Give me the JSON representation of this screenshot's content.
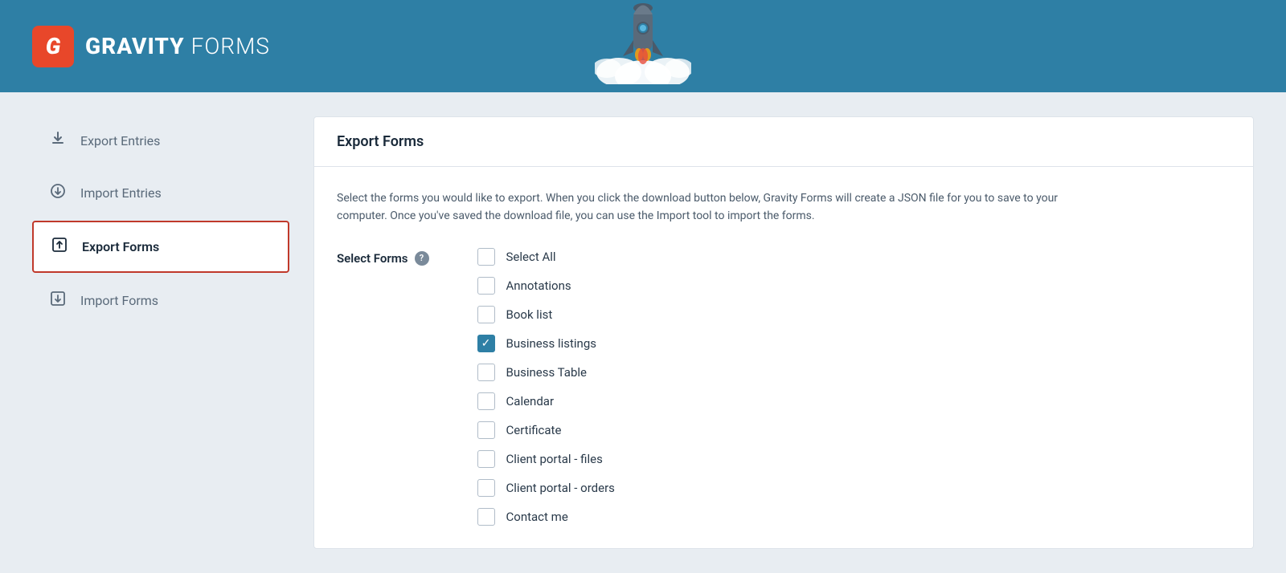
{
  "header": {
    "logo_letter": "G",
    "brand_gravity": "GRAVITY",
    "brand_forms": "FORMS"
  },
  "sidebar": {
    "items": [
      {
        "id": "export-entries",
        "label": "Export Entries",
        "icon": "⬆",
        "active": false
      },
      {
        "id": "import-entries",
        "label": "Import Entries",
        "icon": "↩",
        "active": false
      },
      {
        "id": "export-forms",
        "label": "Export Forms",
        "icon": "⬆",
        "active": true
      },
      {
        "id": "import-forms",
        "label": "Import Forms",
        "icon": "⬇",
        "active": false
      }
    ]
  },
  "content": {
    "panel_title": "Export Forms",
    "description": "Select the forms you would like to export. When you click the download button below, Gravity Forms will create a JSON file for you to save to your computer. Once you've saved the download file, you can use the Import tool to import the forms.",
    "select_forms_label": "Select Forms",
    "help_icon_label": "?",
    "forms": [
      {
        "id": "select-all",
        "label": "Select All",
        "checked": false
      },
      {
        "id": "annotations",
        "label": "Annotations",
        "checked": false
      },
      {
        "id": "book-list",
        "label": "Book list",
        "checked": false
      },
      {
        "id": "business-listings",
        "label": "Business listings",
        "checked": true
      },
      {
        "id": "business-table",
        "label": "Business Table",
        "checked": false
      },
      {
        "id": "calendar",
        "label": "Calendar",
        "checked": false
      },
      {
        "id": "certificate",
        "label": "Certificate",
        "checked": false
      },
      {
        "id": "client-portal-files",
        "label": "Client portal - files",
        "checked": false
      },
      {
        "id": "client-portal-orders",
        "label": "Client portal - orders",
        "checked": false
      },
      {
        "id": "contact-me",
        "label": "Contact me",
        "checked": false
      }
    ]
  }
}
